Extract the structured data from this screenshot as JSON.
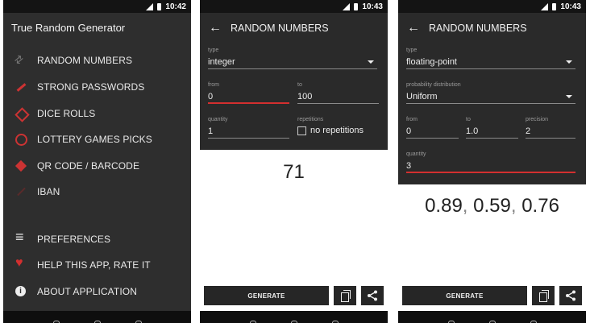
{
  "status": {
    "time_1": "10:42",
    "time_2": "10:43",
    "time_3": "10:43"
  },
  "drawer": {
    "title": "True Random Generator",
    "items": [
      {
        "label": "RANDOM NUMBERS",
        "icon": "arrows-icon"
      },
      {
        "label": "STRONG PASSWORDS",
        "icon": "key-icon"
      },
      {
        "label": "DICE ROLLS",
        "icon": "dice-icon"
      },
      {
        "label": "LOTTERY GAMES PICKS",
        "icon": "lottery-icon"
      },
      {
        "label": "QR CODE / BARCODE",
        "icon": "qr-code-icon"
      },
      {
        "label": "IBAN",
        "icon": "iban-icon"
      }
    ],
    "bottom_items": [
      {
        "label": "PREFERENCES",
        "icon": "preferences-icon"
      },
      {
        "label": "HELP THIS APP, RATE IT",
        "icon": "heart-icon"
      },
      {
        "label": "ABOUT APPLICATION",
        "icon": "info-icon"
      }
    ]
  },
  "screen2": {
    "title": "RANDOM NUMBERS",
    "type_caption": "type",
    "type_value": "integer",
    "from_caption": "from",
    "from_value": "0",
    "to_caption": "to",
    "to_value": "100",
    "quantity_caption": "quantity",
    "quantity_value": "1",
    "repetitions_caption": "repetitions",
    "repetitions_label": "no repetitions",
    "result": "71",
    "generate_label": "GENERATE"
  },
  "screen3": {
    "title": "RANDOM NUMBERS",
    "type_caption": "type",
    "type_value": "floating-point",
    "distribution_caption": "probability distribution",
    "distribution_value": "Uniform",
    "from_caption": "from",
    "from_value": "0",
    "to_caption": "to",
    "to_value": "1.0",
    "precision_caption": "precision",
    "precision_value": "2",
    "quantity_caption": "quantity",
    "quantity_value": "3",
    "results": [
      "0.89",
      "0.59",
      "0.76"
    ],
    "separator": ",",
    "generate_label": "GENERATE"
  },
  "colors": {
    "accent": "#d32f2f",
    "dark_panel": "#2a2a2a",
    "drawer_bg": "#2e2e2e"
  }
}
